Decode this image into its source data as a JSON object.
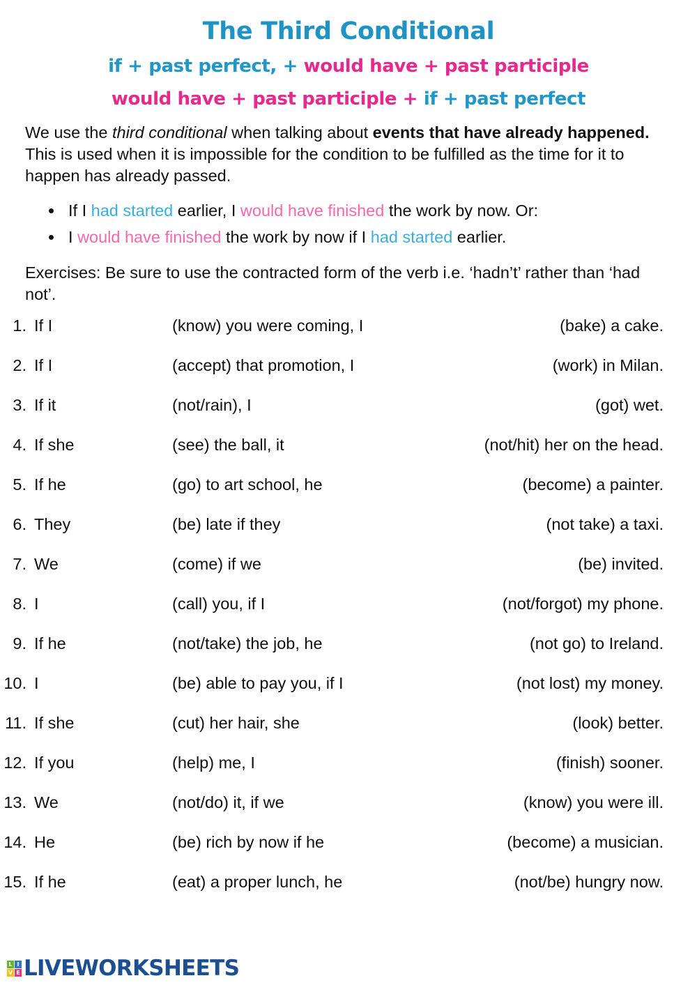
{
  "title": "The Third Conditional",
  "colors": {
    "title_blue": "#1f93c6",
    "formula_blue": "#2096c9",
    "formula_pink": "#e8288c",
    "inline_blue": "#3aaedd",
    "inline_pink": "#f268ae",
    "logo_navy": "#1c4f8f"
  },
  "formula_line1": {
    "blue": "if + past perfect, +",
    "pink": "would have + past participle"
  },
  "formula_line2": {
    "pink": "would have + past participle +",
    "blue": "if + past perfect"
  },
  "intro": {
    "t1": "We use the ",
    "em1": "third conditional",
    "t2": " when talking about ",
    "b1": "events that have already happened.",
    "t3": " This is used when it is impossible for the condition to be fulfilled as the time for it to happen has already passed."
  },
  "examples": [
    {
      "parts": [
        {
          "text": "If I ",
          "color": "none"
        },
        {
          "text": "had started",
          "color": "blue"
        },
        {
          "text": " earlier, I ",
          "color": "none"
        },
        {
          "text": "would have finished",
          "color": "pink"
        },
        {
          "text": " the work by now. Or:",
          "color": "none"
        }
      ]
    },
    {
      "parts": [
        {
          "text": "I ",
          "color": "none"
        },
        {
          "text": "would have finished",
          "color": "pink"
        },
        {
          "text": " the work by now if I ",
          "color": "none"
        },
        {
          "text": "had started",
          "color": "blue"
        },
        {
          "text": " earlier.",
          "color": "none"
        }
      ]
    }
  ],
  "exercises_intro": "Exercises: Be sure to use the contracted form of the verb i.e. ‘hadn’t’ rather than ‘had not’.",
  "exercises": [
    {
      "num": "1.",
      "a": "If I",
      "b": "(know) you were coming, I",
      "c": "(bake) a cake."
    },
    {
      "num": "2.",
      "a": "If I",
      "b": "(accept) that promotion, I",
      "c": "(work) in Milan."
    },
    {
      "num": "3.",
      "a": "If it",
      "b": "(not/rain), I",
      "c": "(got) wet."
    },
    {
      "num": "4.",
      "a": "If she",
      "b": "(see) the ball, it",
      "c": "(not/hit) her on the head."
    },
    {
      "num": "5.",
      "a": "If he",
      "b": "(go) to art school, he",
      "c": "(become) a painter."
    },
    {
      "num": "6.",
      "a": "They",
      "b": "(be) late if they",
      "c": "(not take) a taxi."
    },
    {
      "num": "7.",
      "a": "We",
      "b": "(come) if we",
      "c": "(be) invited."
    },
    {
      "num": "8.",
      "a": "I",
      "b": "(call) you, if I",
      "c": "(not/forgot) my phone."
    },
    {
      "num": "9.",
      "a": "If he",
      "b": "(not/take) the job, he",
      "c": "(not go) to Ireland."
    },
    {
      "num": "10.",
      "a": "I",
      "b": "(be) able to pay you, if I",
      "c": "(not lost) my money."
    },
    {
      "num": "11.",
      "a": "If she",
      "b": "(cut) her hair, she",
      "c": "(look) better."
    },
    {
      "num": "12.",
      "a": "If you",
      "b": "(help) me, I",
      "c": "(finish) sooner."
    },
    {
      "num": "13.",
      "a": "We",
      "b": "(not/do) it, if we",
      "c": "(know) you were ill."
    },
    {
      "num": "14.",
      "a": "He",
      "b": "(be) rich by now if he",
      "c": "(become) a musician."
    },
    {
      "num": "15.",
      "a": "If he",
      "b": "(eat) a proper lunch, he",
      "c": "(not/be) hungry now."
    }
  ],
  "footer": {
    "logo_cells": [
      "L",
      "I",
      "V",
      "E"
    ],
    "wordmark": "LIVEWORKSHEETS"
  }
}
